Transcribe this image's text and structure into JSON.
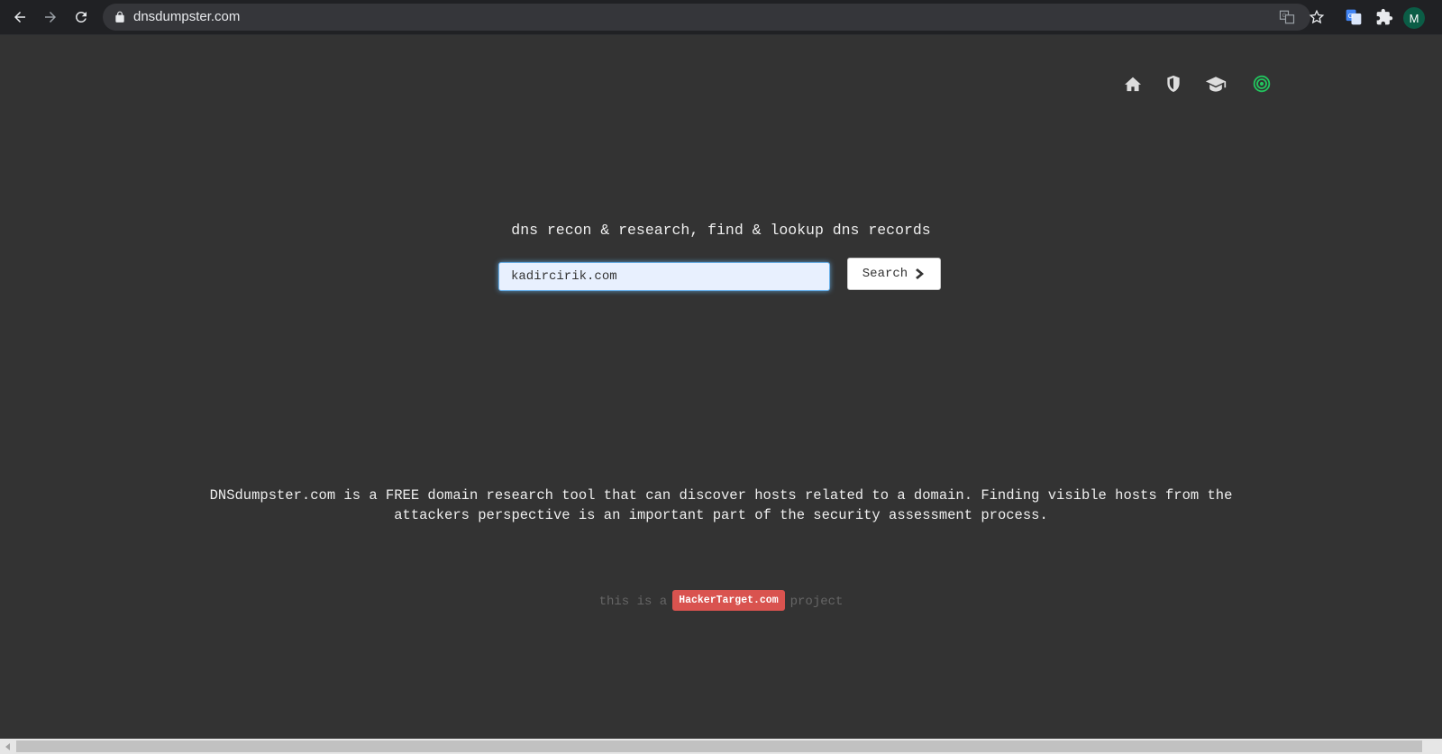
{
  "browser": {
    "url": "dnsdumpster.com",
    "profile_initial": "M"
  },
  "page": {
    "tagline": "dns recon & research, find & lookup dns records",
    "search": {
      "value": "kadircirik.com",
      "button_label": "Search"
    },
    "description": "DNSdumpster.com is a FREE domain research tool that can discover hosts related to a domain. Finding visible hosts from the attackers perspective is an important part of the security assessment process.",
    "footer": {
      "prefix": "this is a",
      "badge": "HackerTarget.com",
      "suffix": "project"
    },
    "top_icons": [
      "home-icon",
      "shield-icon",
      "graduation-cap-icon",
      "target-icon"
    ]
  },
  "colors": {
    "background": "#333333",
    "badge": "#d9534f",
    "target_icon": "#22c55e",
    "input_focus": "#66afe9"
  }
}
